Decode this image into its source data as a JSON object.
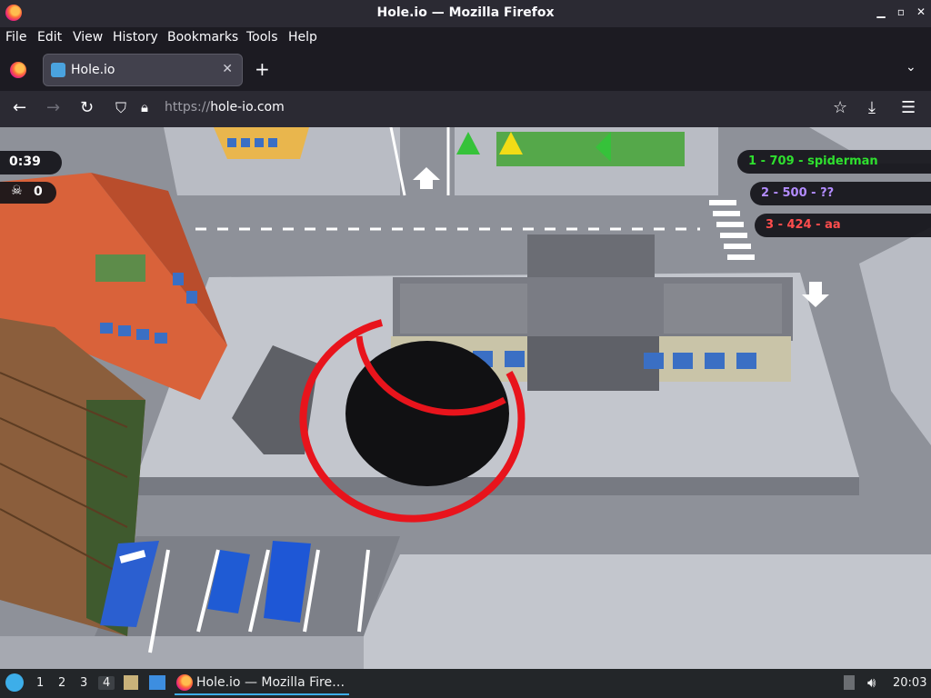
{
  "window": {
    "title": "Hole.io — Mozilla Firefox",
    "controls": [
      "minimize",
      "maximize",
      "close"
    ]
  },
  "menu": [
    "File",
    "Edit",
    "View",
    "History",
    "Bookmarks",
    "Tools",
    "Help"
  ],
  "tab": {
    "label": "Hole.io",
    "close_icon": "close-icon"
  },
  "navbar": {
    "url_scheme": "https://",
    "url_host": "hole-io.com"
  },
  "game": {
    "timer": "0:39",
    "score": "0",
    "leaderboard": [
      {
        "text": "1 - 709 - spiderman",
        "color": "#2fe02f"
      },
      {
        "text": "2 - 500 - ??",
        "color": "#b38cff"
      },
      {
        "text": "3 - 424 - aa",
        "color": "#ff4d4d"
      }
    ],
    "markers": [
      "you",
      "??",
      "spiderman"
    ],
    "hole_ring_color": "#e8141c"
  },
  "taskbar": {
    "workspaces": [
      "1",
      "2",
      "3",
      "4"
    ],
    "active_workspace": "4",
    "task_label": "Hole.io — Mozilla Fire…",
    "clock": "20:03"
  }
}
